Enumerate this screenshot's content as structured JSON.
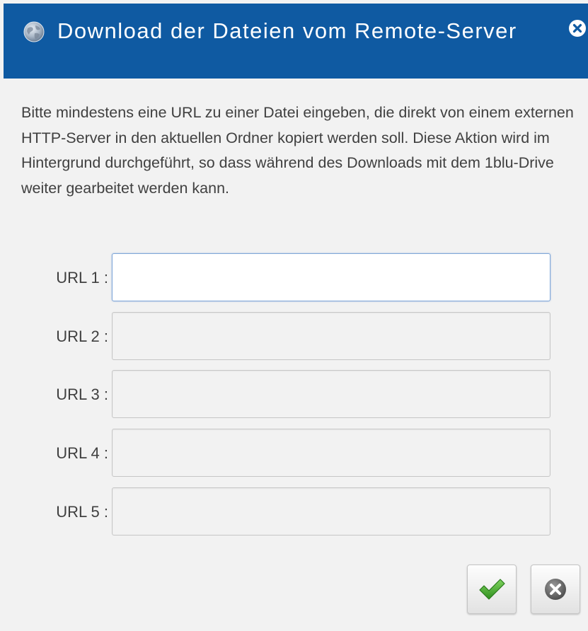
{
  "dialog": {
    "title": "Download der Dateien vom Remote-Server",
    "title_icon": "globe-icon",
    "close_icon": "close-icon",
    "header_color": "#0f5aa2"
  },
  "description": "Bitte mindestens eine URL zu einer Datei eingeben, die direkt von einem externen HTTP-Server in den aktuellen Ordner kopiert werden soll. Diese Aktion wird im Hintergrund durchgeführt, so dass während des Downloads mit dem 1blu-Drive weiter gearbeitet werden kann.",
  "url_fields": [
    {
      "label": "URL 1 :",
      "value": "",
      "focused": true
    },
    {
      "label": "URL 2 :",
      "value": ""
    },
    {
      "label": "URL 3 :",
      "value": ""
    },
    {
      "label": "URL 4 :",
      "value": ""
    },
    {
      "label": "URL 5 :",
      "value": ""
    }
  ],
  "buttons": {
    "confirm_icon": "checkmark-icon",
    "cancel_icon": "cancel-icon",
    "confirm_color": "#3aa02a",
    "cancel_color": "#6b6b6b"
  }
}
